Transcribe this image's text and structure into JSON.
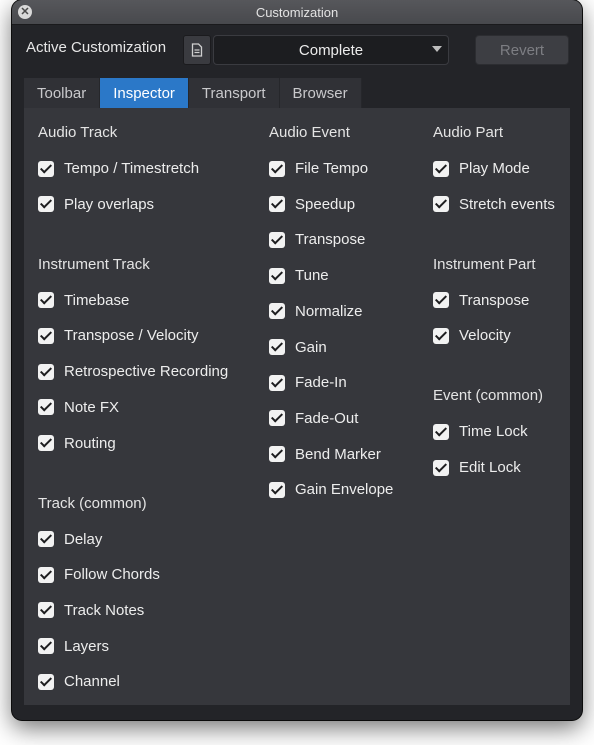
{
  "window": {
    "title": "Customization"
  },
  "toolbar": {
    "active_label": "Active Customization",
    "selected": "Complete",
    "revert_label": "Revert"
  },
  "tabs": [
    {
      "label": "Toolbar",
      "active": false
    },
    {
      "label": "Inspector",
      "active": true
    },
    {
      "label": "Transport",
      "active": false
    },
    {
      "label": "Browser",
      "active": false
    }
  ],
  "columns": [
    {
      "groups": [
        {
          "title": "Audio Track",
          "items": [
            {
              "label": "Tempo / Timestretch",
              "checked": true
            },
            {
              "label": "Play overlaps",
              "checked": true
            }
          ]
        },
        {
          "title": "Instrument Track",
          "items": [
            {
              "label": "Timebase",
              "checked": true
            },
            {
              "label": "Transpose / Velocity",
              "checked": true
            },
            {
              "label": "Retrospective Recording",
              "checked": true
            },
            {
              "label": "Note FX",
              "checked": true
            },
            {
              "label": "Routing",
              "checked": true
            }
          ]
        },
        {
          "title": "Track (common)",
          "items": [
            {
              "label": "Delay",
              "checked": true
            },
            {
              "label": "Follow Chords",
              "checked": true
            },
            {
              "label": "Track Notes",
              "checked": true
            },
            {
              "label": "Layers",
              "checked": true
            },
            {
              "label": "Channel",
              "checked": true
            }
          ]
        }
      ]
    },
    {
      "groups": [
        {
          "title": "Audio Event",
          "items": [
            {
              "label": "File Tempo",
              "checked": true
            },
            {
              "label": "Speedup",
              "checked": true
            },
            {
              "label": "Transpose",
              "checked": true
            },
            {
              "label": "Tune",
              "checked": true
            },
            {
              "label": "Normalize",
              "checked": true
            },
            {
              "label": "Gain",
              "checked": true
            },
            {
              "label": "Fade-In",
              "checked": true
            },
            {
              "label": "Fade-Out",
              "checked": true
            },
            {
              "label": "Bend Marker",
              "checked": true
            },
            {
              "label": "Gain Envelope",
              "checked": true
            }
          ]
        }
      ]
    },
    {
      "groups": [
        {
          "title": "Audio Part",
          "items": [
            {
              "label": "Play Mode",
              "checked": true
            },
            {
              "label": "Stretch events",
              "checked": true
            }
          ]
        },
        {
          "title": "Instrument Part",
          "items": [
            {
              "label": "Transpose",
              "checked": true
            },
            {
              "label": "Velocity",
              "checked": true
            }
          ]
        },
        {
          "title": "Event (common)",
          "items": [
            {
              "label": "Time Lock",
              "checked": true
            },
            {
              "label": "Edit Lock",
              "checked": true
            }
          ]
        }
      ]
    }
  ]
}
